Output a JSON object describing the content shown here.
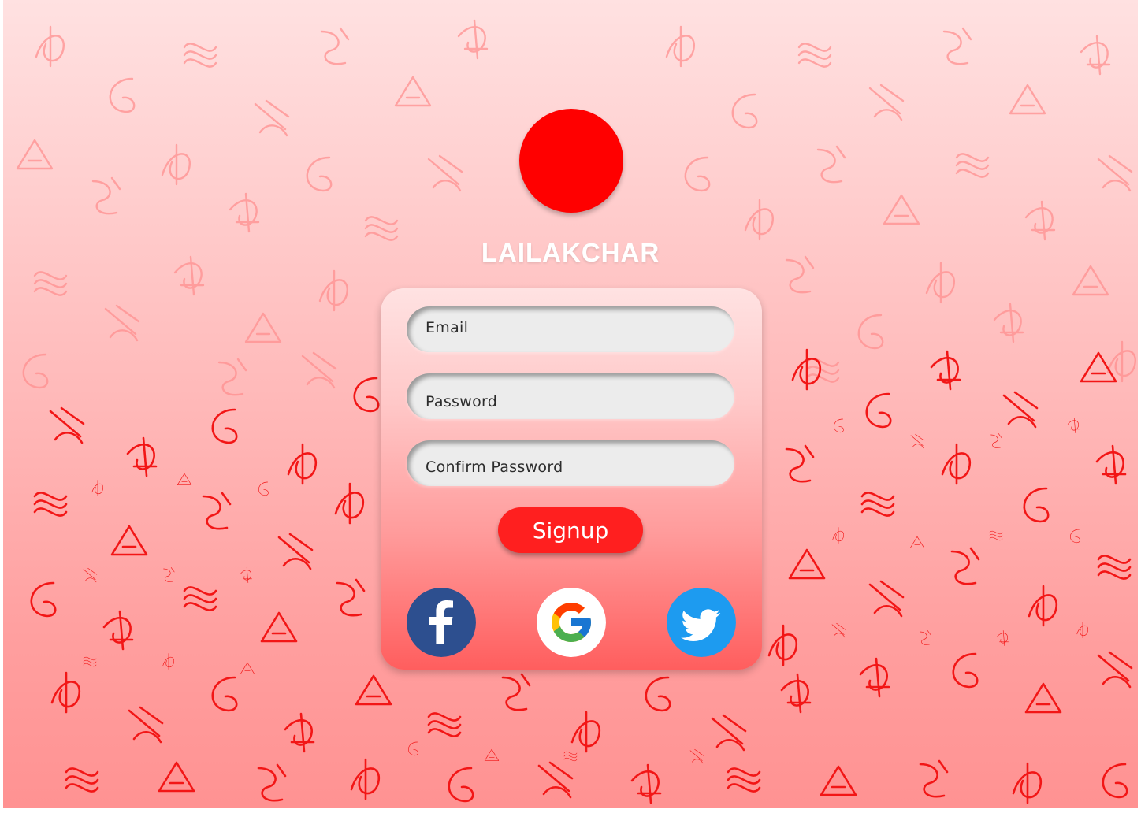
{
  "app": {
    "brand_name": "LAILAKCHAR"
  },
  "form": {
    "email_placeholder": "Email",
    "password_placeholder": "Password",
    "confirm_password_placeholder": "Confirm Password",
    "signup_label": "Signup"
  },
  "social": [
    {
      "icon": "facebook-icon",
      "color": "#2d4f8f"
    },
    {
      "icon": "google-icon",
      "color": "#ffffff"
    },
    {
      "icon": "twitter-icon",
      "color": "#1d9bf0"
    }
  ],
  "colors": {
    "accent": "#ff0000",
    "button": "#ff1f1f",
    "pattern": "#e60000"
  }
}
